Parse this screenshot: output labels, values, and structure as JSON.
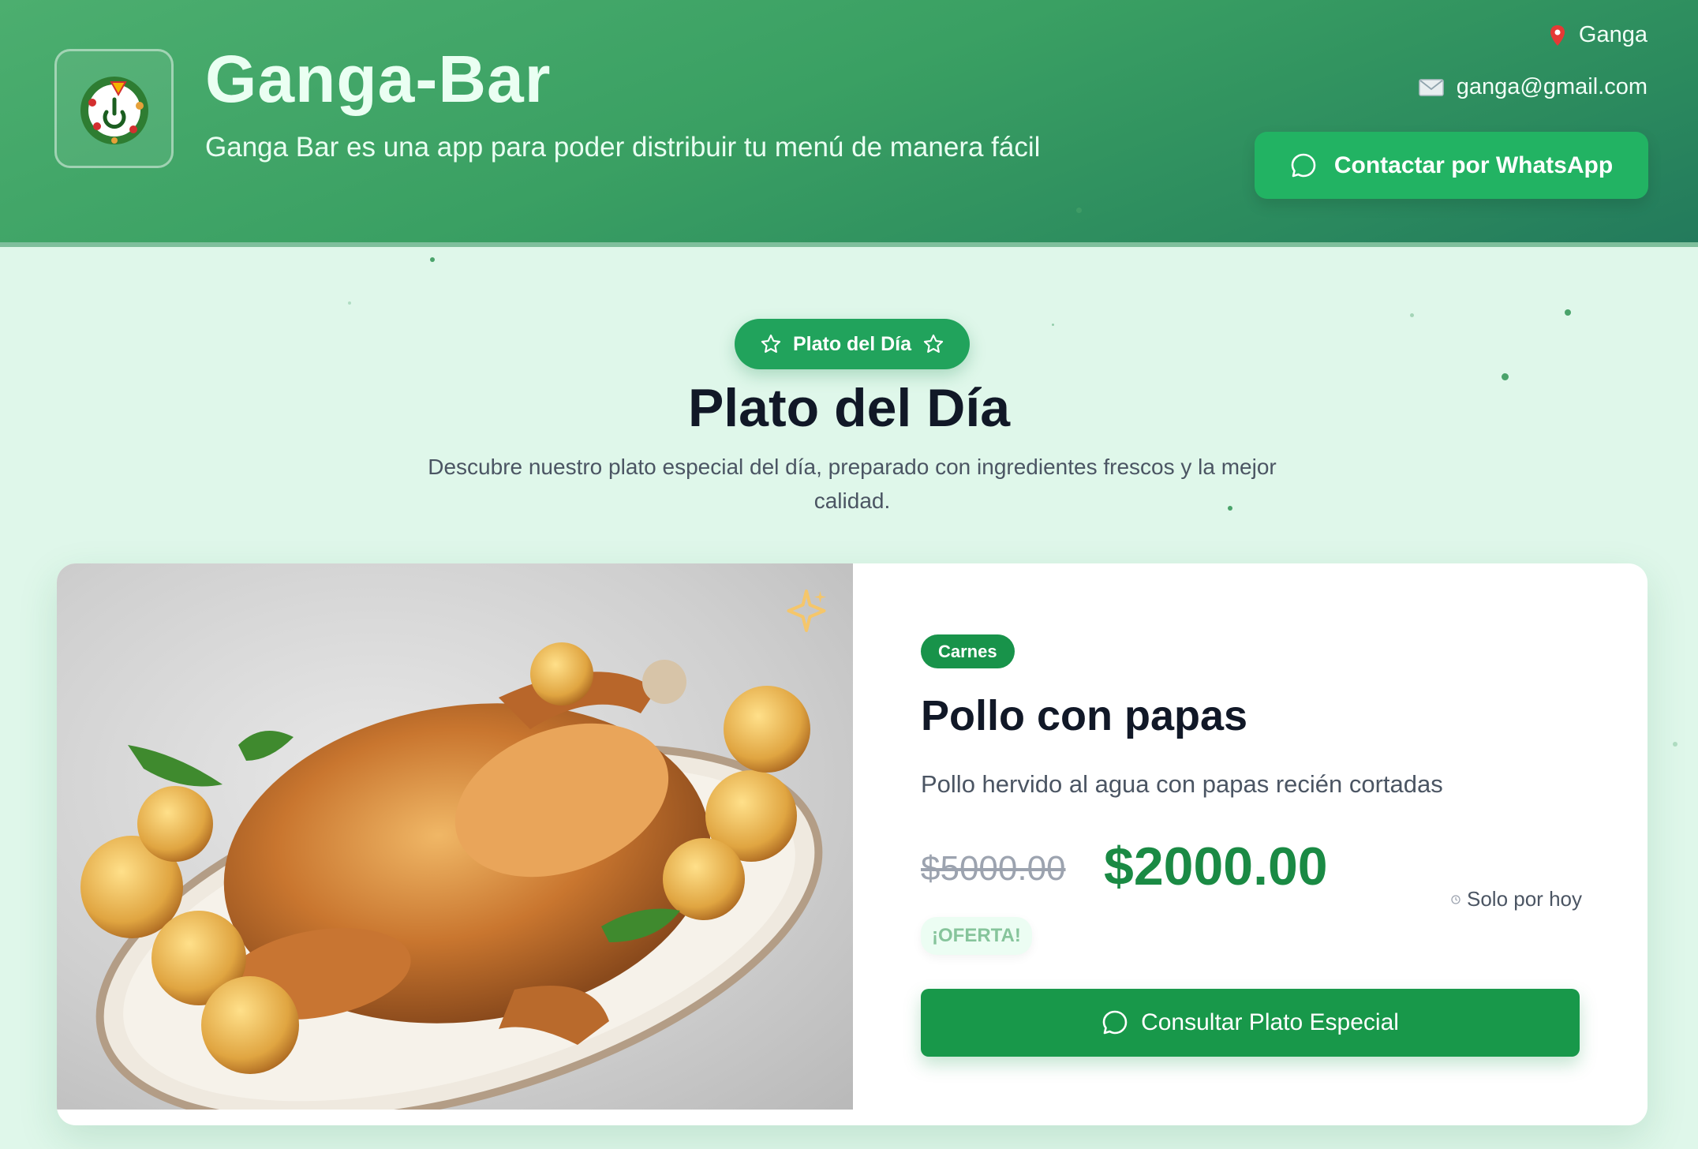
{
  "header": {
    "brand": "Ganga-Bar",
    "tagline": "Ganga Bar es una app para poder distribuir tu menú de manera fácil",
    "location": "Ganga",
    "email": "ganga@gmail.com",
    "whatsapp_label": "Contactar por WhatsApp"
  },
  "section": {
    "pill_label": "Plato del Día",
    "title": "Plato del Día",
    "subtitle": "Descubre nuestro plato especial del día, preparado con ingredientes frescos y la mejor calidad."
  },
  "dish": {
    "category": "Carnes",
    "name": "Pollo con papas",
    "description": "Pollo hervido al agua con papas recién cortadas",
    "old_price": "$5000.00",
    "price": "$2000.00",
    "availability": "Solo por hoy",
    "offer_badge": "¡OFERTA!",
    "cta_label": "Consultar Plato Especial"
  },
  "icons": {
    "location": "map-pin-icon",
    "email": "envelope-icon",
    "whatsapp": "chat-bubble-icon",
    "pill": "star-icon",
    "sparkle": "sparkle-icon",
    "clock": "clock-icon"
  },
  "colors": {
    "primary": "#18984a",
    "header": "#3aa063",
    "background": "#dff7ea",
    "price": "#1a8a44"
  }
}
